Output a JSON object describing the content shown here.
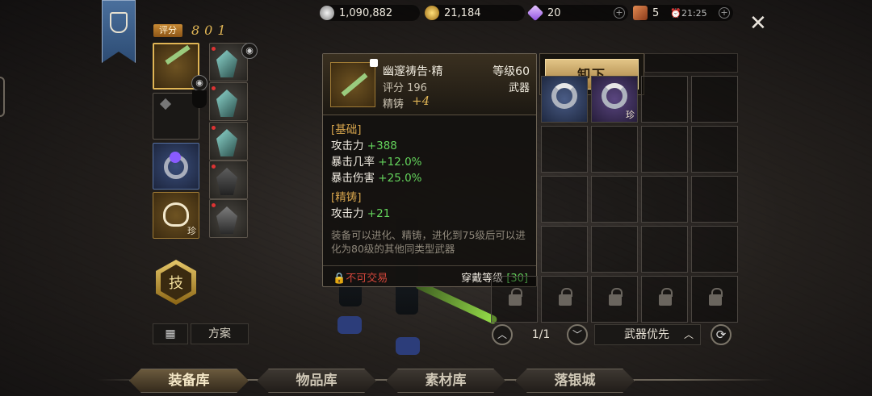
{
  "currencies": [
    {
      "name": "silver",
      "value": "1,090,882",
      "color": "#c9c9c9"
    },
    {
      "name": "gold",
      "value": "21,184",
      "color": "#d9a531"
    },
    {
      "name": "diamond",
      "value": "20",
      "color": "#b884ff"
    },
    {
      "name": "ticket",
      "value": "5",
      "color": "#b8552b"
    }
  ],
  "clock": "⏰21:25",
  "score": {
    "label": "评分",
    "value": "801"
  },
  "skill_label": "技",
  "plan_label": "方案",
  "tooltip": {
    "name": "幽邃祷告·精",
    "level": "等级60",
    "score": "评分 196",
    "type": "武器",
    "refine_label": "精铸",
    "refine_value": "+4",
    "sections": {
      "base_title": "[基础]",
      "base_stats": [
        {
          "name": "攻击力",
          "value": "+388"
        },
        {
          "name": "暴击几率",
          "value": "+12.0%"
        },
        {
          "name": "暴击伤害",
          "value": "+25.0%"
        }
      ],
      "refine_title": "[精铸]",
      "refine_stats": [
        {
          "name": "攻击力",
          "value": "+21"
        }
      ]
    },
    "description": "装备可以进化、精铸，进化到75级后可以进化为80级的其他同类型武器",
    "untradeable": "不可交易",
    "wear_level_label": "穿戴等级",
    "wear_level_value": "[30]"
  },
  "unequip_label": "卸下",
  "rare_mark": "珍",
  "pagination": {
    "current": "1/1"
  },
  "sort_label": "武器优先",
  "tabs": [
    "装备库",
    "物品库",
    "素材库",
    "落银城"
  ]
}
